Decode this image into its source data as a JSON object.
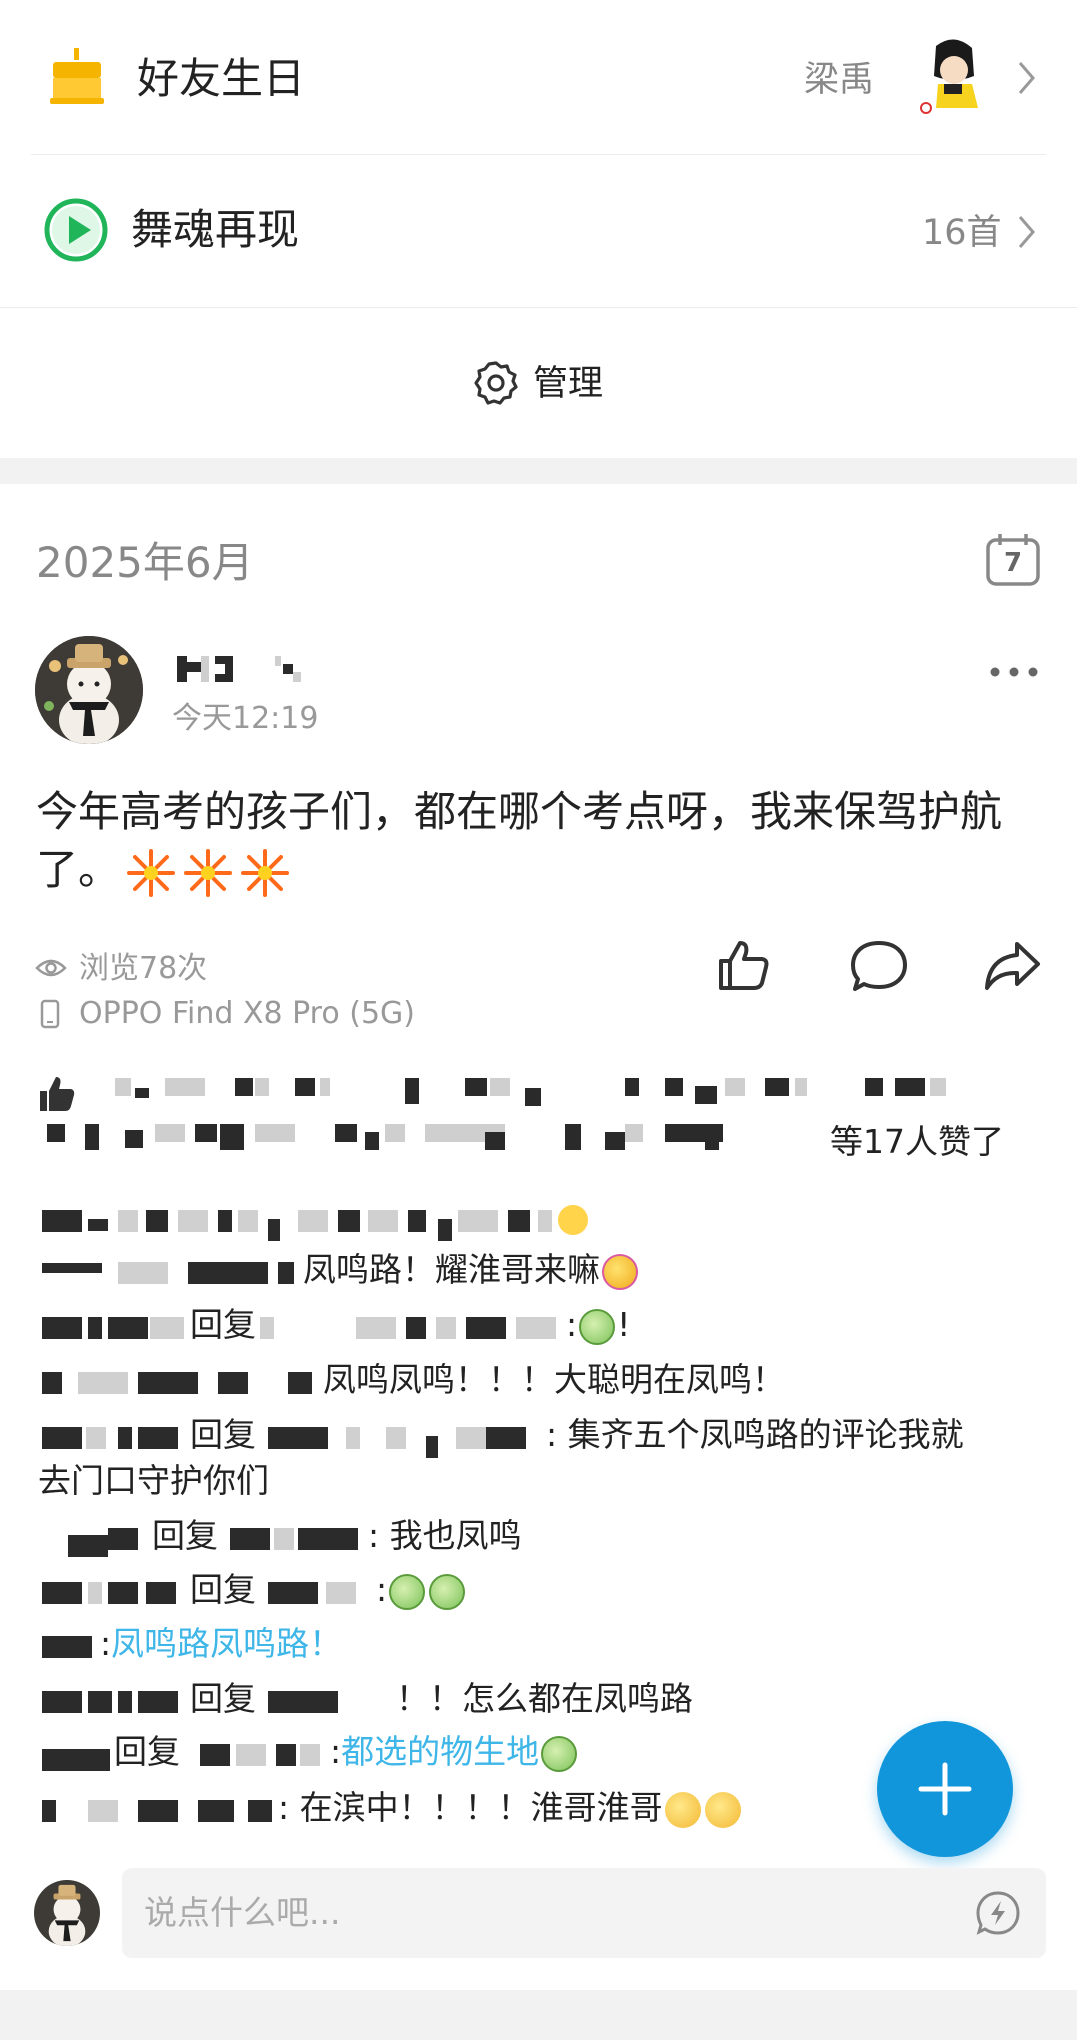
{
  "birthday": {
    "title": "好友生日",
    "friend": "梁禹"
  },
  "dance": {
    "title": "舞魂再现",
    "count": "16首"
  },
  "manage": {
    "label": "管理"
  },
  "month_header": {
    "label": "2025年6月",
    "calendar_day": "7"
  },
  "post": {
    "time": "今天12:19",
    "content": "今年高考的孩子们，都在哪个考点呀，我来保驾护航了。",
    "views": "浏览78次",
    "device": "OPPO Find X8 Pro (5G)",
    "likes_text": "等17人赞了"
  },
  "comments": [
    {
      "text": ""
    },
    {
      "text": "凤鸣路！耀淮哥来嘛"
    },
    {
      "reply": "回复",
      "text": ":",
      "suffix": "!"
    },
    {
      "text": "凤鸣凤鸣！！！大聪明在凤鸣！"
    },
    {
      "reply": "回复",
      "text": ": 集齐五个凤鸣路的评论我就",
      "text2": "去门口守护你们"
    },
    {
      "reply": "回复",
      "text": ": 我也凤鸣"
    },
    {
      "reply": "回复",
      "text": ":"
    },
    {
      "text": ":",
      "link": "凤鸣路凤鸣路！"
    },
    {
      "reply": "回复",
      "text": "！！怎么都在凤鸣路"
    },
    {
      "reply": "回复",
      "text": ":",
      "link": "都选的物生地"
    },
    {
      "text": ": 在滨中！！！！淮哥淮哥"
    }
  ],
  "input": {
    "placeholder": "说点什么吧..."
  },
  "colors": {
    "accent": "#1296db",
    "link": "#3fb6e8",
    "play_green": "#21b55a",
    "cake_orange": "#f5b400"
  },
  "icons": [
    "cake-icon",
    "chevron-right-icon",
    "play-icon",
    "gear-icon",
    "calendar-icon",
    "more-icon",
    "eye-icon",
    "phone-icon",
    "like-icon",
    "comment-icon",
    "share-icon",
    "thumb-icon",
    "plus-icon",
    "lightning-icon"
  ]
}
